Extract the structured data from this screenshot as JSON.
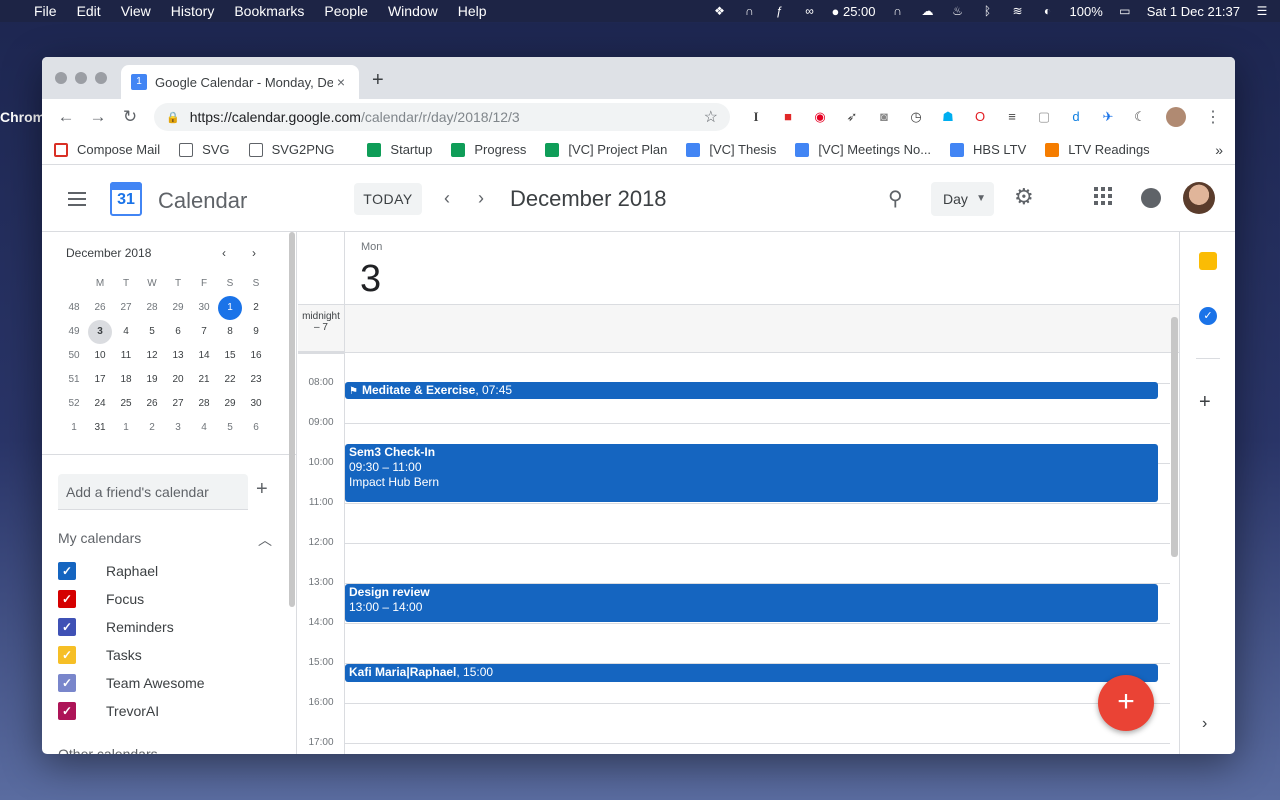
{
  "menubar": {
    "app": "Chrome",
    "items": [
      "File",
      "Edit",
      "View",
      "History",
      "Bookmarks",
      "People",
      "Window",
      "Help"
    ],
    "timer": "25:00",
    "battery": "100%",
    "datetime": "Sat 1 Dec  21:37"
  },
  "browser": {
    "tab_title": "Google Calendar - Monday, De",
    "url_host": "https://calendar.google.com",
    "url_path": "/calendar/r/day/2018/12/3",
    "bookmarks": [
      {
        "label": "Compose Mail",
        "icon": "gmail"
      },
      {
        "label": "SVG",
        "icon": "file"
      },
      {
        "label": "SVG2PNG",
        "icon": "file"
      },
      {
        "label": "Startup",
        "icon": "sheet"
      },
      {
        "label": "Progress",
        "icon": "sheet"
      },
      {
        "label": "[VC] Project Plan",
        "icon": "sheet"
      },
      {
        "label": "[VC] Thesis",
        "icon": "doc"
      },
      {
        "label": "[VC] Meetings No...",
        "icon": "doc"
      },
      {
        "label": "HBS LTV",
        "icon": "hbs"
      },
      {
        "label": "LTV Readings",
        "icon": "blog"
      }
    ],
    "more": "»"
  },
  "header": {
    "logo_day": "31",
    "title": "Calendar",
    "today": "TODAY",
    "month": "December 2018",
    "view": "Day"
  },
  "mini": {
    "title": "December 2018",
    "days": [
      "M",
      "T",
      "W",
      "T",
      "F",
      "S",
      "S"
    ],
    "weeks": [
      {
        "wk": "48",
        "d": [
          "26",
          "27",
          "28",
          "29",
          "30",
          "1",
          "2"
        ]
      },
      {
        "wk": "49",
        "d": [
          "3",
          "4",
          "5",
          "6",
          "7",
          "8",
          "9"
        ]
      },
      {
        "wk": "50",
        "d": [
          "10",
          "11",
          "12",
          "13",
          "14",
          "15",
          "16"
        ]
      },
      {
        "wk": "51",
        "d": [
          "17",
          "18",
          "19",
          "20",
          "21",
          "22",
          "23"
        ]
      },
      {
        "wk": "52",
        "d": [
          "24",
          "25",
          "26",
          "27",
          "28",
          "29",
          "30"
        ]
      },
      {
        "wk": "1",
        "d": [
          "31",
          "1",
          "2",
          "3",
          "4",
          "5",
          "6"
        ]
      }
    ]
  },
  "sidebar": {
    "friend_placeholder": "Add a friend's calendar",
    "my_calendars": "My calendars",
    "calendars": [
      {
        "name": "Raphael",
        "color": "#1565c0"
      },
      {
        "name": "Focus",
        "color": "#d50000"
      },
      {
        "name": "Reminders",
        "color": "#3f51b5"
      },
      {
        "name": "Tasks",
        "color": "#f6bf26"
      },
      {
        "name": "Team Awesome",
        "color": "#7986cb"
      },
      {
        "name": "TrevorAI",
        "color": "#ad1457"
      }
    ],
    "other_calendars": "Other calendars"
  },
  "day": {
    "name": "Mon",
    "number": "3",
    "allday_label": "midnight – 7",
    "hours": [
      "08:00",
      "09:00",
      "10:00",
      "11:00",
      "12:00",
      "13:00",
      "14:00",
      "15:00",
      "16:00",
      "17:00"
    ],
    "events": [
      {
        "title": "Meditate & Exercise",
        "time": ", 07:45",
        "flag": true
      },
      {
        "title": "Sem3 Check-In",
        "time": "09:30 – 11:00",
        "location": "Impact Hub Bern"
      },
      {
        "title": "Design review",
        "time": "13:00 – 14:00"
      },
      {
        "title": "Kafi Maria|Raphael",
        "time": ", 15:00"
      }
    ]
  },
  "fab": "+"
}
